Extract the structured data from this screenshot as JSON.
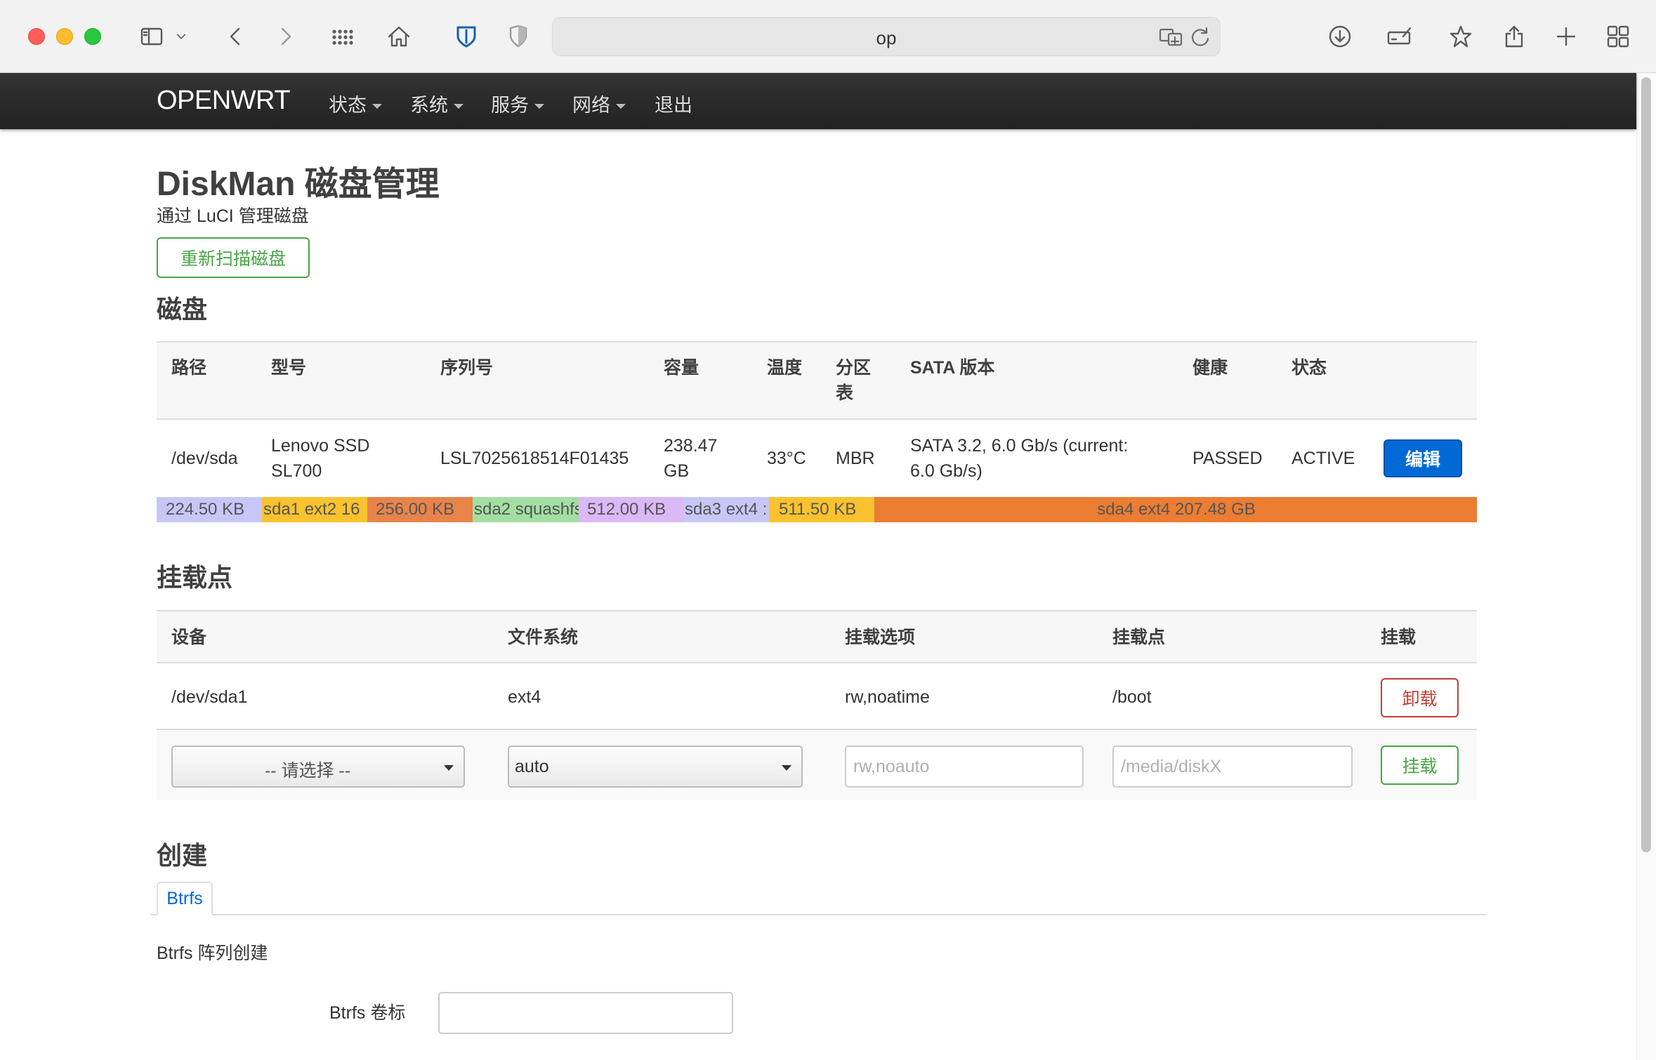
{
  "browser": {
    "url": "op"
  },
  "nav": {
    "brand": "OPENWRT",
    "items": [
      {
        "label": "状态",
        "dropdown": true
      },
      {
        "label": "系统",
        "dropdown": true
      },
      {
        "label": "服务",
        "dropdown": true
      },
      {
        "label": "网络",
        "dropdown": true
      },
      {
        "label": "退出",
        "dropdown": false
      }
    ]
  },
  "page": {
    "title": "DiskMan 磁盘管理",
    "subtitle": "通过 LuCI 管理磁盘",
    "rescan_label": "重新扫描磁盘"
  },
  "disks": {
    "heading": "磁盘",
    "columns": [
      "路径",
      "型号",
      "序列号",
      "容量",
      "温度",
      "分区\n表",
      "SATA 版本",
      "健康",
      "状态"
    ],
    "rows": [
      {
        "path": "/dev/sda",
        "model": "Lenovo SSD\nSL700",
        "serial": "LSL7025618514F01435",
        "capacity": "238.47\nGB",
        "temp": "33°C",
        "table": "MBR",
        "sata": "SATA 3.2, 6.0 Gb/s (current:\n6.0 Gb/s)",
        "health": "PASSED",
        "status": "ACTIVE",
        "edit_label": "编辑"
      }
    ],
    "partitions": [
      {
        "label": "224.50 KB",
        "color": "#c7c7f7"
      },
      {
        "label": "sda1 ext2 16",
        "color": "#f9c22e"
      },
      {
        "label": "256.00 KB",
        "color": "#e8844a"
      },
      {
        "label": "sda2 squashfs",
        "color": "#a3dfa3"
      },
      {
        "label": "512.00 KB",
        "color": "#dbb8f6"
      },
      {
        "label": "sda3 ext4 :",
        "color": "#c7c7f7"
      },
      {
        "label": "511.50 KB",
        "color": "#f9c22e"
      },
      {
        "label": "sda4 ext4 207.48 GB",
        "color": "#ec7d32"
      }
    ]
  },
  "mounts": {
    "heading": "挂载点",
    "columns": [
      "设备",
      "文件系统",
      "挂载选项",
      "挂载点",
      "挂载"
    ],
    "rows": [
      {
        "device": "/dev/sda1",
        "fs": "ext4",
        "options": "rw,noatime",
        "mountpoint": "/boot",
        "action_label": "卸载"
      }
    ],
    "new_row": {
      "device_select": "-- 请选择 --",
      "fs_select": "auto",
      "options_placeholder": "rw,noauto",
      "mountpoint_placeholder": "/media/diskX",
      "mount_label": "挂载"
    }
  },
  "create": {
    "heading": "创建",
    "tab_label": "Btrfs",
    "section_title": "Btrfs 阵列创建",
    "label_field": "Btrfs 卷标",
    "label_value": ""
  }
}
